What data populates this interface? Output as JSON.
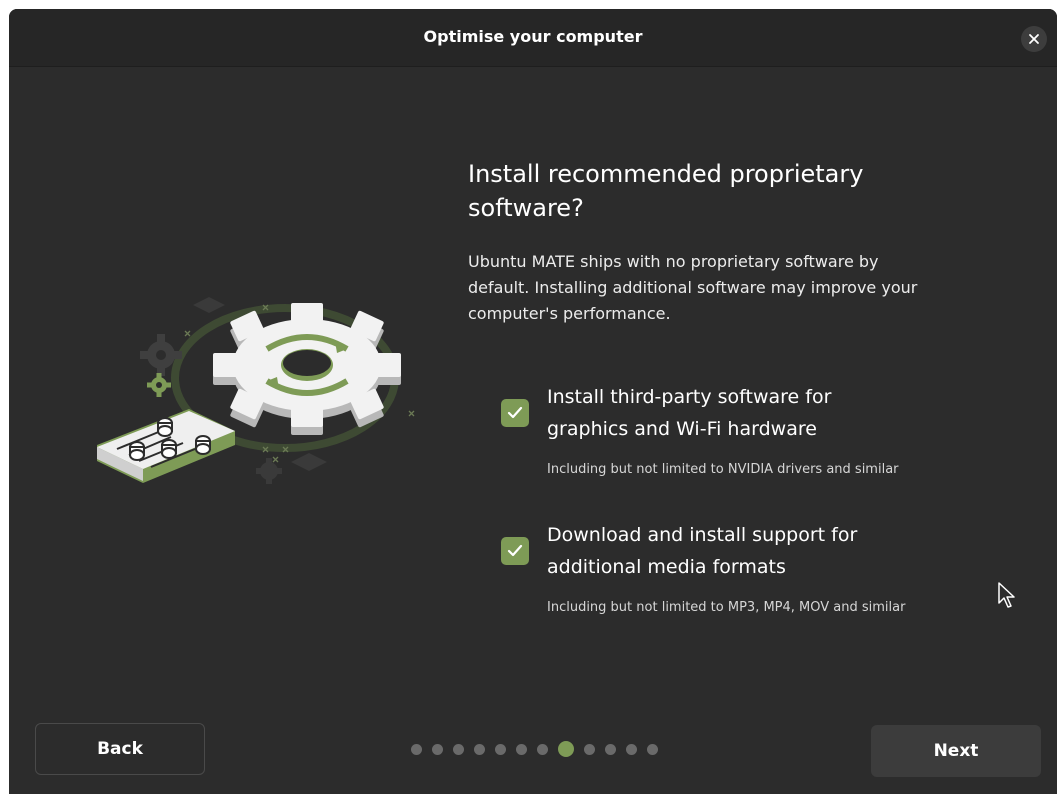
{
  "window": {
    "title": "Optimise your computer"
  },
  "main": {
    "heading": "Install recommended proprietary software?",
    "description": "Ubuntu MATE ships with no proprietary software by default. Installing additional software may improve your computer's performance.",
    "options": [
      {
        "label": "Install third-party software for graphics and Wi-Fi hardware",
        "sublabel": "Including but not limited to NVIDIA drivers and similar",
        "checked": true
      },
      {
        "label": "Download and install support for additional media formats",
        "sublabel": "Including but not limited to MP3, MP4, MOV and similar",
        "checked": true
      }
    ]
  },
  "footer": {
    "back_label": "Back",
    "next_label": "Next",
    "pages_total": 12,
    "page_current": 8
  },
  "colors": {
    "accent": "#7e9b56",
    "background": "#2c2c2c",
    "headerbar": "#262626"
  },
  "icons": {
    "close": "close-icon",
    "check": "checkmark-icon",
    "illustration": "gear-settings-illustration",
    "cursor": "mouse-pointer-icon"
  }
}
